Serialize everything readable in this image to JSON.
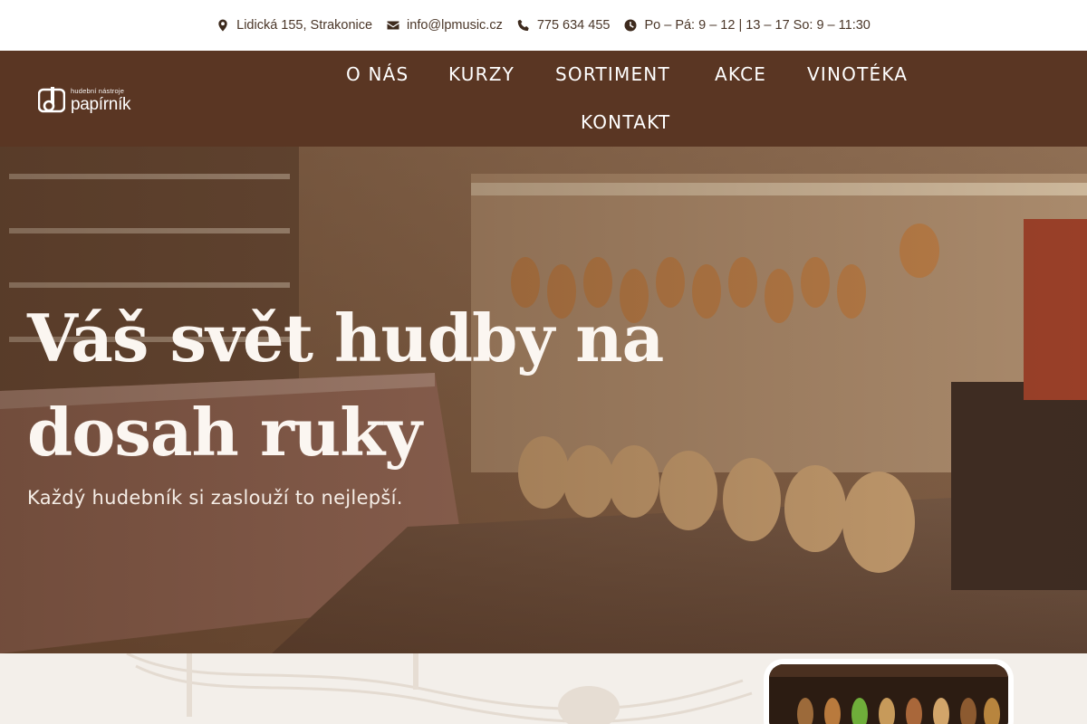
{
  "topbar": {
    "address": "Lidická 155, Strakonice",
    "email": "info@lpmusic.cz",
    "phone": "775 634 455",
    "hours": "Po – Pá: 9 – 12 | 13 – 17 So: 9 – 11:30",
    "icons": [
      "map-pin-icon",
      "envelope-icon",
      "phone-icon",
      "clock-icon"
    ]
  },
  "logo": {
    "small": "hudební nástroje",
    "big": "papírník"
  },
  "nav": {
    "items": [
      "O NÁS",
      "KURZY",
      "SORTIMENT",
      "AKCE",
      "VINOTÉKA",
      "KONTAKT"
    ]
  },
  "hero": {
    "title": "Váš svět hudby na dosah ruky",
    "subtitle": "Každý hudebník si zaslouží to nejlepší."
  },
  "colors": {
    "header_bg": "#5a3623",
    "topbar_text": "#4a3628",
    "bottom_bg": "#f3efea"
  }
}
